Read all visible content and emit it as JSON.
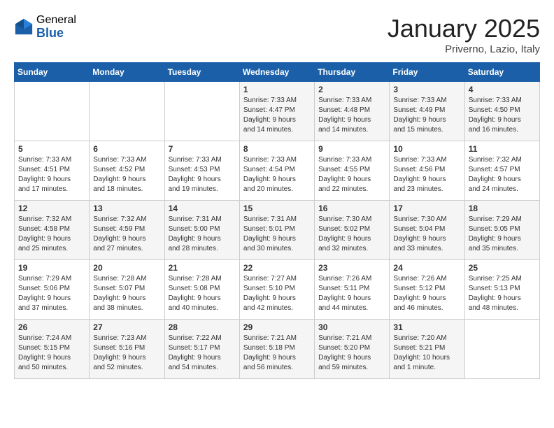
{
  "header": {
    "logo_general": "General",
    "logo_blue": "Blue",
    "month_title": "January 2025",
    "location": "Priverno, Lazio, Italy"
  },
  "weekdays": [
    "Sunday",
    "Monday",
    "Tuesday",
    "Wednesday",
    "Thursday",
    "Friday",
    "Saturday"
  ],
  "weeks": [
    [
      {
        "day": "",
        "info": ""
      },
      {
        "day": "",
        "info": ""
      },
      {
        "day": "",
        "info": ""
      },
      {
        "day": "1",
        "info": "Sunrise: 7:33 AM\nSunset: 4:47 PM\nDaylight: 9 hours\nand 14 minutes."
      },
      {
        "day": "2",
        "info": "Sunrise: 7:33 AM\nSunset: 4:48 PM\nDaylight: 9 hours\nand 14 minutes."
      },
      {
        "day": "3",
        "info": "Sunrise: 7:33 AM\nSunset: 4:49 PM\nDaylight: 9 hours\nand 15 minutes."
      },
      {
        "day": "4",
        "info": "Sunrise: 7:33 AM\nSunset: 4:50 PM\nDaylight: 9 hours\nand 16 minutes."
      }
    ],
    [
      {
        "day": "5",
        "info": "Sunrise: 7:33 AM\nSunset: 4:51 PM\nDaylight: 9 hours\nand 17 minutes."
      },
      {
        "day": "6",
        "info": "Sunrise: 7:33 AM\nSunset: 4:52 PM\nDaylight: 9 hours\nand 18 minutes."
      },
      {
        "day": "7",
        "info": "Sunrise: 7:33 AM\nSunset: 4:53 PM\nDaylight: 9 hours\nand 19 minutes."
      },
      {
        "day": "8",
        "info": "Sunrise: 7:33 AM\nSunset: 4:54 PM\nDaylight: 9 hours\nand 20 minutes."
      },
      {
        "day": "9",
        "info": "Sunrise: 7:33 AM\nSunset: 4:55 PM\nDaylight: 9 hours\nand 22 minutes."
      },
      {
        "day": "10",
        "info": "Sunrise: 7:33 AM\nSunset: 4:56 PM\nDaylight: 9 hours\nand 23 minutes."
      },
      {
        "day": "11",
        "info": "Sunrise: 7:32 AM\nSunset: 4:57 PM\nDaylight: 9 hours\nand 24 minutes."
      }
    ],
    [
      {
        "day": "12",
        "info": "Sunrise: 7:32 AM\nSunset: 4:58 PM\nDaylight: 9 hours\nand 25 minutes."
      },
      {
        "day": "13",
        "info": "Sunrise: 7:32 AM\nSunset: 4:59 PM\nDaylight: 9 hours\nand 27 minutes."
      },
      {
        "day": "14",
        "info": "Sunrise: 7:31 AM\nSunset: 5:00 PM\nDaylight: 9 hours\nand 28 minutes."
      },
      {
        "day": "15",
        "info": "Sunrise: 7:31 AM\nSunset: 5:01 PM\nDaylight: 9 hours\nand 30 minutes."
      },
      {
        "day": "16",
        "info": "Sunrise: 7:30 AM\nSunset: 5:02 PM\nDaylight: 9 hours\nand 32 minutes."
      },
      {
        "day": "17",
        "info": "Sunrise: 7:30 AM\nSunset: 5:04 PM\nDaylight: 9 hours\nand 33 minutes."
      },
      {
        "day": "18",
        "info": "Sunrise: 7:29 AM\nSunset: 5:05 PM\nDaylight: 9 hours\nand 35 minutes."
      }
    ],
    [
      {
        "day": "19",
        "info": "Sunrise: 7:29 AM\nSunset: 5:06 PM\nDaylight: 9 hours\nand 37 minutes."
      },
      {
        "day": "20",
        "info": "Sunrise: 7:28 AM\nSunset: 5:07 PM\nDaylight: 9 hours\nand 38 minutes."
      },
      {
        "day": "21",
        "info": "Sunrise: 7:28 AM\nSunset: 5:08 PM\nDaylight: 9 hours\nand 40 minutes."
      },
      {
        "day": "22",
        "info": "Sunrise: 7:27 AM\nSunset: 5:10 PM\nDaylight: 9 hours\nand 42 minutes."
      },
      {
        "day": "23",
        "info": "Sunrise: 7:26 AM\nSunset: 5:11 PM\nDaylight: 9 hours\nand 44 minutes."
      },
      {
        "day": "24",
        "info": "Sunrise: 7:26 AM\nSunset: 5:12 PM\nDaylight: 9 hours\nand 46 minutes."
      },
      {
        "day": "25",
        "info": "Sunrise: 7:25 AM\nSunset: 5:13 PM\nDaylight: 9 hours\nand 48 minutes."
      }
    ],
    [
      {
        "day": "26",
        "info": "Sunrise: 7:24 AM\nSunset: 5:15 PM\nDaylight: 9 hours\nand 50 minutes."
      },
      {
        "day": "27",
        "info": "Sunrise: 7:23 AM\nSunset: 5:16 PM\nDaylight: 9 hours\nand 52 minutes."
      },
      {
        "day": "28",
        "info": "Sunrise: 7:22 AM\nSunset: 5:17 PM\nDaylight: 9 hours\nand 54 minutes."
      },
      {
        "day": "29",
        "info": "Sunrise: 7:21 AM\nSunset: 5:18 PM\nDaylight: 9 hours\nand 56 minutes."
      },
      {
        "day": "30",
        "info": "Sunrise: 7:21 AM\nSunset: 5:20 PM\nDaylight: 9 hours\nand 59 minutes."
      },
      {
        "day": "31",
        "info": "Sunrise: 7:20 AM\nSunset: 5:21 PM\nDaylight: 10 hours\nand 1 minute."
      },
      {
        "day": "",
        "info": ""
      }
    ]
  ]
}
